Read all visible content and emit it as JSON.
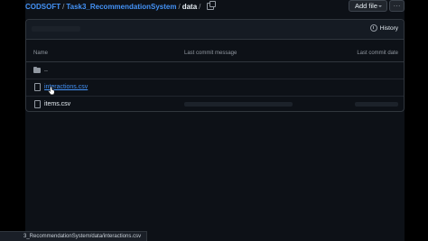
{
  "breadcrumb": {
    "owner": "CODSOFT",
    "repo": "Task3_RecommendationSystem",
    "current": "data",
    "separator": "/"
  },
  "header_actions": {
    "add_file_label": "Add file",
    "more_label": "···"
  },
  "panel": {
    "history_label": "History",
    "columns": {
      "name": "Name",
      "message": "Last commit message",
      "date": "Last commit date"
    },
    "rows": [
      {
        "name": "..",
        "type": "folder"
      },
      {
        "name": "interactions.csv",
        "type": "file"
      },
      {
        "name": "items.csv",
        "type": "file"
      }
    ]
  },
  "status_bar": {
    "url": "3_RecommendationSystem/data/interactions.csv"
  },
  "colors": {
    "background": "#0d1117",
    "link": "#4493f8",
    "muted": "#9198a1",
    "border": "#30363d"
  }
}
